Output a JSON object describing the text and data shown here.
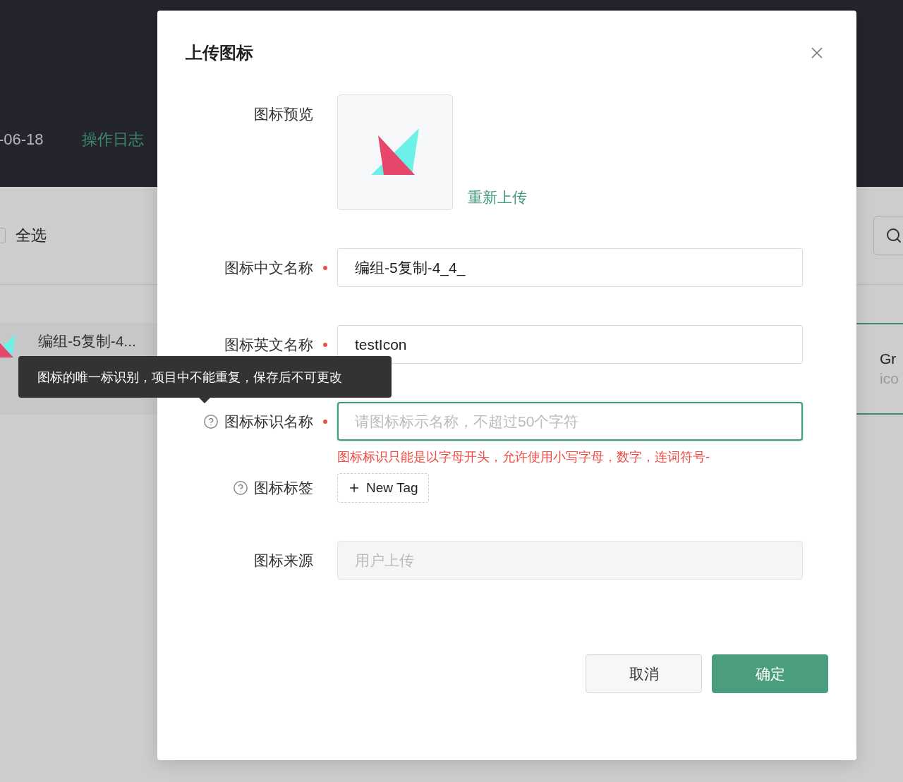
{
  "background": {
    "date": "-06-18",
    "log_link": "操作日志",
    "select_all": {
      "label": "全选",
      "checked": false
    },
    "list_item": {
      "name": "编组-5复制-4..."
    },
    "card": {
      "title": "Gr",
      "subtitle": "ico"
    }
  },
  "dialog": {
    "title": "上传图标",
    "fields": [
      {
        "kind": "preview",
        "label": "图标预览",
        "required": false,
        "help": false,
        "action": "重新上传"
      },
      {
        "kind": "input",
        "label": "图标中文名称",
        "required": true,
        "help": false,
        "value": "编组-5复制-4_4_",
        "focused": false,
        "disabled": false
      },
      {
        "kind": "input",
        "label": "图标英文名称",
        "required": true,
        "help": false,
        "value": "testIcon",
        "focused": false,
        "disabled": false
      },
      {
        "kind": "input",
        "label": "图标标识名称",
        "required": true,
        "help": true,
        "placeholder": "请图标标示名称，不超过50个字符",
        "focused": true,
        "disabled": false,
        "error": "图标标识只能是以字母开头，允许使用小写字母，数字，连词符号-"
      },
      {
        "kind": "tags",
        "label": "图标标签",
        "required": false,
        "help": true,
        "add_label": "New Tag"
      },
      {
        "kind": "input",
        "label": "图标来源",
        "required": false,
        "help": false,
        "value": "用户上传",
        "focused": false,
        "disabled": true
      }
    ],
    "buttons": [
      {
        "label": "取消",
        "kind": "default"
      },
      {
        "label": "确定",
        "kind": "primary"
      }
    ]
  },
  "tooltip": {
    "text": "图标的唯一标识别，项目中不能重复，保存后不可更改"
  }
}
